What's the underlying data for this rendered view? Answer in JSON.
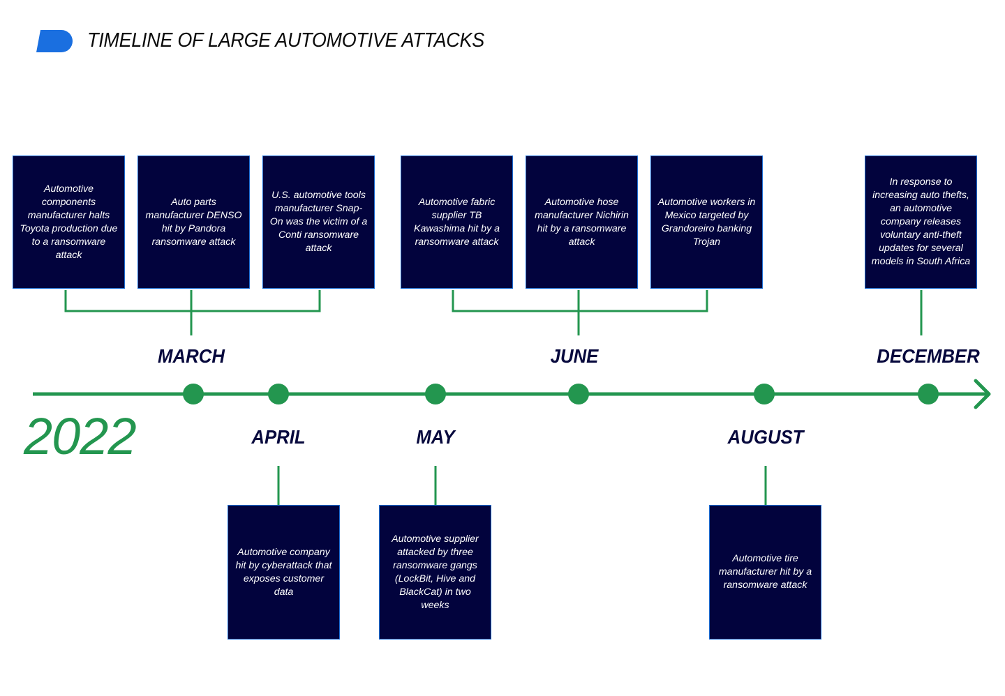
{
  "header": {
    "title": "TIMELINE OF LARGE AUTOMOTIVE ATTACKS",
    "logo_icon": "logo-d-shape",
    "logo_color": "#1a6fe0"
  },
  "year": "2022",
  "colors": {
    "line": "#23964f",
    "box_bg": "#02033d",
    "box_border": "#1e6fd6",
    "month_text": "#07093d"
  },
  "months": [
    {
      "name": "MARCH",
      "position": "above"
    },
    {
      "name": "APRIL",
      "position": "below"
    },
    {
      "name": "MAY",
      "position": "below"
    },
    {
      "name": "JUNE",
      "position": "above"
    },
    {
      "name": "AUGUST",
      "position": "below"
    },
    {
      "name": "DECEMBER",
      "position": "above"
    }
  ],
  "events": {
    "march": [
      "Automotive components manufacturer halts Toyota production due to a ransomware attack",
      "Auto parts manufacturer DENSO hit by Pandora ransomware attack",
      "U.S. automotive tools manufacturer Snap-On was the victim of a Conti ransomware attack"
    ],
    "april": [
      "Automotive company hit by cyberattack that exposes customer data"
    ],
    "may": [
      "Automotive supplier attacked by three ransomware gangs (LockBit, Hive and BlackCat) in two weeks"
    ],
    "june": [
      "Automotive fabric supplier TB Kawashima hit by a ransomware attack",
      "Automotive hose manufacturer Nichirin hit by a ransomware attack",
      "Automotive workers in Mexico targeted by Grandoreiro banking Trojan"
    ],
    "august": [
      "Automotive tire manufacturer hit by a ransomware attack"
    ],
    "december": [
      "In response to increasing auto thefts, an automotive company releases voluntary anti-theft updates for several models in South Africa"
    ]
  }
}
